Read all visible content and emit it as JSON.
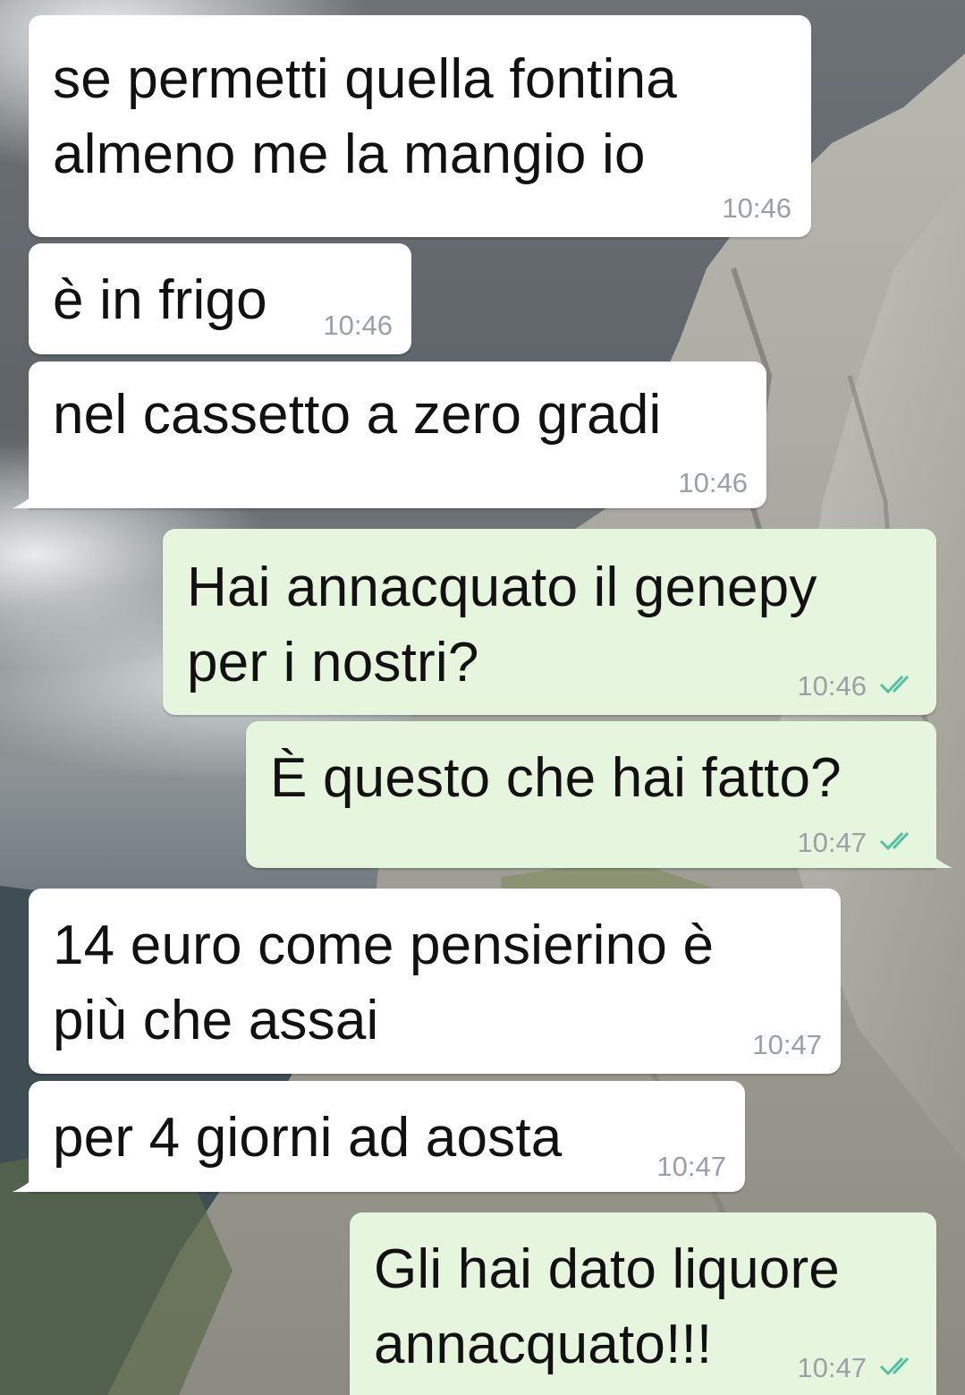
{
  "chat": {
    "messages": [
      {
        "direction": "incoming",
        "text": "se permetti quella fontina\nalmeno me la mangio io",
        "time": "10:46"
      },
      {
        "direction": "incoming",
        "text": "è in frigo",
        "time": "10:46"
      },
      {
        "direction": "incoming",
        "text": "nel cassetto a zero gradi",
        "time": "10:46"
      },
      {
        "direction": "outgoing",
        "text": "Hai annacquato il genepy\nper i nostri?",
        "time": "10:46",
        "status": "read"
      },
      {
        "direction": "outgoing",
        "text": "È questo che hai fatto?",
        "time": "10:47",
        "status": "read"
      },
      {
        "direction": "incoming",
        "text": "14 euro come pensierino è\npiù che assai",
        "time": "10:47"
      },
      {
        "direction": "incoming",
        "text": "per 4 giorni ad aosta",
        "time": "10:47"
      },
      {
        "direction": "outgoing",
        "text": "Gli hai dato liquore\nannacquato!!!",
        "time": "10:47",
        "status": "read"
      }
    ]
  },
  "icons": {
    "read_receipt": "double-check-icon"
  },
  "colors": {
    "incoming_bubble": "#ffffff",
    "outgoing_bubble": "#e6f6de",
    "timestamp": "#9aa0a3",
    "read_tick": "#4fc3a1"
  }
}
